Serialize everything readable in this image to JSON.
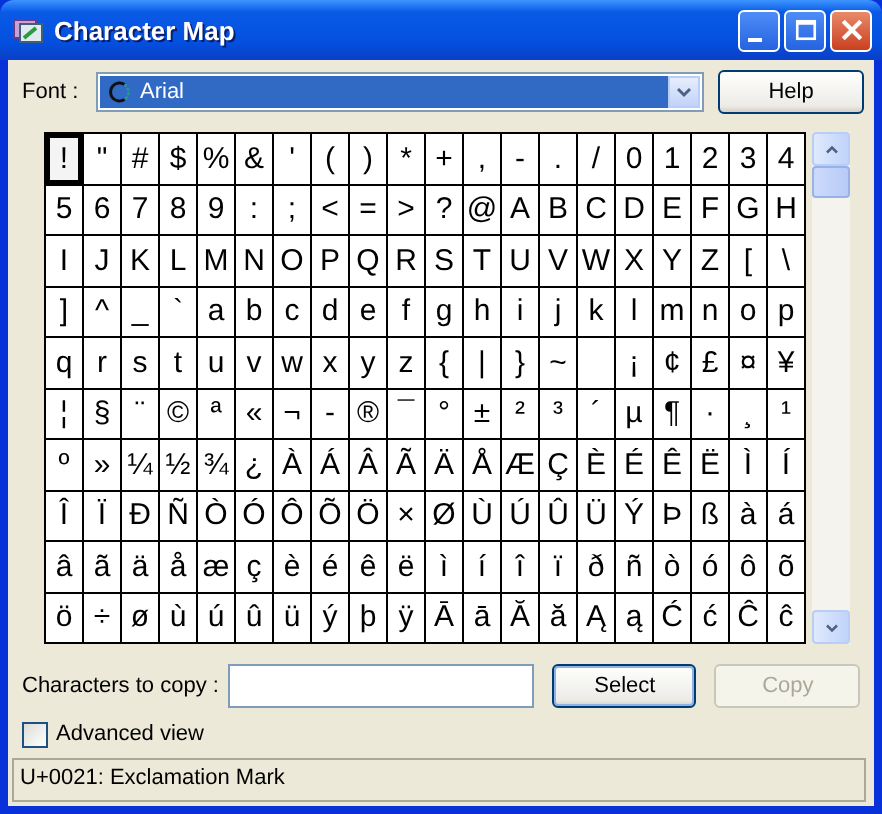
{
  "window": {
    "title": "Character Map"
  },
  "font": {
    "label": "Font :",
    "value": "Arial"
  },
  "help_button": "Help",
  "grid": [
    [
      {
        "char": "!",
        "selected": true
      },
      {
        "char": "\"",
        "selected": false
      },
      {
        "char": "#",
        "selected": false
      },
      {
        "char": "$",
        "selected": false
      },
      {
        "char": "%",
        "selected": false
      },
      {
        "char": "&",
        "selected": false
      },
      {
        "char": "'",
        "selected": false
      },
      {
        "char": "(",
        "selected": false
      },
      {
        "char": ")",
        "selected": false
      },
      {
        "char": "*",
        "selected": false
      },
      {
        "char": "+",
        "selected": false
      },
      {
        "char": ",",
        "selected": false
      },
      {
        "char": "-",
        "selected": false
      },
      {
        "char": ".",
        "selected": false
      },
      {
        "char": "/",
        "selected": false
      },
      {
        "char": "0",
        "selected": false
      },
      {
        "char": "1",
        "selected": false
      },
      {
        "char": "2",
        "selected": false
      },
      {
        "char": "3",
        "selected": false
      },
      {
        "char": "4",
        "selected": false
      }
    ],
    [
      {
        "char": "5",
        "selected": false
      },
      {
        "char": "6",
        "selected": false
      },
      {
        "char": "7",
        "selected": false
      },
      {
        "char": "8",
        "selected": false
      },
      {
        "char": "9",
        "selected": false
      },
      {
        "char": ":",
        "selected": false
      },
      {
        "char": ";",
        "selected": false
      },
      {
        "char": "<",
        "selected": false
      },
      {
        "char": "=",
        "selected": false
      },
      {
        "char": ">",
        "selected": false
      },
      {
        "char": "?",
        "selected": false
      },
      {
        "char": "@",
        "selected": false
      },
      {
        "char": "A",
        "selected": false
      },
      {
        "char": "B",
        "selected": false
      },
      {
        "char": "C",
        "selected": false
      },
      {
        "char": "D",
        "selected": false
      },
      {
        "char": "E",
        "selected": false
      },
      {
        "char": "F",
        "selected": false
      },
      {
        "char": "G",
        "selected": false
      },
      {
        "char": "H",
        "selected": false
      }
    ],
    [
      {
        "char": "I",
        "selected": false
      },
      {
        "char": "J",
        "selected": false
      },
      {
        "char": "K",
        "selected": false
      },
      {
        "char": "L",
        "selected": false
      },
      {
        "char": "M",
        "selected": false
      },
      {
        "char": "N",
        "selected": false
      },
      {
        "char": "O",
        "selected": false
      },
      {
        "char": "P",
        "selected": false
      },
      {
        "char": "Q",
        "selected": false
      },
      {
        "char": "R",
        "selected": false
      },
      {
        "char": "S",
        "selected": false
      },
      {
        "char": "T",
        "selected": false
      },
      {
        "char": "U",
        "selected": false
      },
      {
        "char": "V",
        "selected": false
      },
      {
        "char": "W",
        "selected": false
      },
      {
        "char": "X",
        "selected": false
      },
      {
        "char": "Y",
        "selected": false
      },
      {
        "char": "Z",
        "selected": false
      },
      {
        "char": "[",
        "selected": false
      },
      {
        "char": "\\",
        "selected": false
      }
    ],
    [
      {
        "char": "]",
        "selected": false
      },
      {
        "char": "^",
        "selected": false
      },
      {
        "char": "_",
        "selected": false
      },
      {
        "char": "`",
        "selected": false
      },
      {
        "char": "a",
        "selected": false
      },
      {
        "char": "b",
        "selected": false
      },
      {
        "char": "c",
        "selected": false
      },
      {
        "char": "d",
        "selected": false
      },
      {
        "char": "e",
        "selected": false
      },
      {
        "char": "f",
        "selected": false
      },
      {
        "char": "g",
        "selected": false
      },
      {
        "char": "h",
        "selected": false
      },
      {
        "char": "i",
        "selected": false
      },
      {
        "char": "j",
        "selected": false
      },
      {
        "char": "k",
        "selected": false
      },
      {
        "char": "l",
        "selected": false
      },
      {
        "char": "m",
        "selected": false
      },
      {
        "char": "n",
        "selected": false
      },
      {
        "char": "o",
        "selected": false
      },
      {
        "char": "p",
        "selected": false
      }
    ],
    [
      {
        "char": "q",
        "selected": false
      },
      {
        "char": "r",
        "selected": false
      },
      {
        "char": "s",
        "selected": false
      },
      {
        "char": "t",
        "selected": false
      },
      {
        "char": "u",
        "selected": false
      },
      {
        "char": "v",
        "selected": false
      },
      {
        "char": "w",
        "selected": false
      },
      {
        "char": "x",
        "selected": false
      },
      {
        "char": "y",
        "selected": false
      },
      {
        "char": "z",
        "selected": false
      },
      {
        "char": "{",
        "selected": false
      },
      {
        "char": "|",
        "selected": false
      },
      {
        "char": "}",
        "selected": false
      },
      {
        "char": "~",
        "selected": false
      },
      {
        "selected": false
      },
      {
        "char": "¡",
        "selected": false
      },
      {
        "char": "¢",
        "selected": false
      },
      {
        "char": "£",
        "selected": false
      },
      {
        "char": "¤",
        "selected": false
      },
      {
        "char": "¥",
        "selected": false
      }
    ],
    [
      {
        "char": "¦",
        "selected": false
      },
      {
        "char": "§",
        "selected": false
      },
      {
        "char": "¨",
        "selected": false
      },
      {
        "char": "©",
        "selected": false
      },
      {
        "char": "ª",
        "selected": false
      },
      {
        "char": "«",
        "selected": false
      },
      {
        "char": "¬",
        "selected": false
      },
      {
        "char": "-",
        "selected": false
      },
      {
        "char": "®",
        "selected": false
      },
      {
        "char": "¯",
        "selected": false
      },
      {
        "char": "°",
        "selected": false
      },
      {
        "char": "±",
        "selected": false
      },
      {
        "char": "²",
        "selected": false
      },
      {
        "char": "³",
        "selected": false
      },
      {
        "char": "´",
        "selected": false
      },
      {
        "char": "µ",
        "selected": false
      },
      {
        "char": "¶",
        "selected": false
      },
      {
        "char": "·",
        "selected": false
      },
      {
        "char": "¸",
        "selected": false
      },
      {
        "char": "¹",
        "selected": false
      }
    ],
    [
      {
        "char": "º",
        "selected": false
      },
      {
        "char": "»",
        "selected": false
      },
      {
        "char": "¼",
        "selected": false
      },
      {
        "char": "½",
        "selected": false
      },
      {
        "char": "¾",
        "selected": false
      },
      {
        "char": "¿",
        "selected": false
      },
      {
        "char": "À",
        "selected": false
      },
      {
        "char": "Á",
        "selected": false
      },
      {
        "char": "Â",
        "selected": false
      },
      {
        "char": "Ã",
        "selected": false
      },
      {
        "char": "Ä",
        "selected": false
      },
      {
        "char": "Å",
        "selected": false
      },
      {
        "char": "Æ",
        "selected": false
      },
      {
        "char": "Ç",
        "selected": false
      },
      {
        "char": "È",
        "selected": false
      },
      {
        "char": "É",
        "selected": false
      },
      {
        "char": "Ê",
        "selected": false
      },
      {
        "char": "Ë",
        "selected": false
      },
      {
        "char": "Ì",
        "selected": false
      },
      {
        "char": "Í",
        "selected": false
      }
    ],
    [
      {
        "char": "Î",
        "selected": false
      },
      {
        "char": "Ï",
        "selected": false
      },
      {
        "char": "Ð",
        "selected": false
      },
      {
        "char": "Ñ",
        "selected": false
      },
      {
        "char": "Ò",
        "selected": false
      },
      {
        "char": "Ó",
        "selected": false
      },
      {
        "char": "Ô",
        "selected": false
      },
      {
        "char": "Õ",
        "selected": false
      },
      {
        "char": "Ö",
        "selected": false
      },
      {
        "char": "×",
        "selected": false
      },
      {
        "char": "Ø",
        "selected": false
      },
      {
        "char": "Ù",
        "selected": false
      },
      {
        "char": "Ú",
        "selected": false
      },
      {
        "char": "Û",
        "selected": false
      },
      {
        "char": "Ü",
        "selected": false
      },
      {
        "char": "Ý",
        "selected": false
      },
      {
        "char": "Þ",
        "selected": false
      },
      {
        "char": "ß",
        "selected": false
      },
      {
        "char": "à",
        "selected": false
      },
      {
        "char": "á",
        "selected": false
      }
    ],
    [
      {
        "char": "â",
        "selected": false
      },
      {
        "char": "ã",
        "selected": false
      },
      {
        "char": "ä",
        "selected": false
      },
      {
        "char": "å",
        "selected": false
      },
      {
        "char": "æ",
        "selected": false
      },
      {
        "char": "ç",
        "selected": false
      },
      {
        "char": "è",
        "selected": false
      },
      {
        "char": "é",
        "selected": false
      },
      {
        "char": "ê",
        "selected": false
      },
      {
        "char": "ë",
        "selected": false
      },
      {
        "char": "ì",
        "selected": false
      },
      {
        "char": "í",
        "selected": false
      },
      {
        "char": "î",
        "selected": false
      },
      {
        "char": "ï",
        "selected": false
      },
      {
        "char": "ð",
        "selected": false
      },
      {
        "char": "ñ",
        "selected": false
      },
      {
        "char": "ò",
        "selected": false
      },
      {
        "char": "ó",
        "selected": false
      },
      {
        "char": "ô",
        "selected": false
      },
      {
        "char": "õ",
        "selected": false
      }
    ],
    [
      {
        "char": "ö",
        "selected": false
      },
      {
        "char": "÷",
        "selected": false
      },
      {
        "char": "ø",
        "selected": false
      },
      {
        "char": "ù",
        "selected": false
      },
      {
        "char": "ú",
        "selected": false
      },
      {
        "char": "û",
        "selected": false
      },
      {
        "char": "ü",
        "selected": false
      },
      {
        "char": "ý",
        "selected": false
      },
      {
        "char": "þ",
        "selected": false
      },
      {
        "char": "ÿ",
        "selected": false
      },
      {
        "char": "Ā",
        "selected": false
      },
      {
        "char": "ā",
        "selected": false
      },
      {
        "char": "Ă",
        "selected": false
      },
      {
        "char": "ă",
        "selected": false
      },
      {
        "char": "Ą",
        "selected": false
      },
      {
        "char": "ą",
        "selected": false
      },
      {
        "char": "Ć",
        "selected": false
      },
      {
        "char": "ć",
        "selected": false
      },
      {
        "char": "Ĉ",
        "selected": false
      },
      {
        "char": "ĉ",
        "selected": false
      }
    ]
  ],
  "copy": {
    "label": "Characters to copy :",
    "select_button": "Select",
    "copy_button": {
      "label": "Copy",
      "disabled": true
    }
  },
  "advanced_view": {
    "label": "Advanced view",
    "checked": false
  },
  "status_bar": "U+0021: Exclamation Mark"
}
